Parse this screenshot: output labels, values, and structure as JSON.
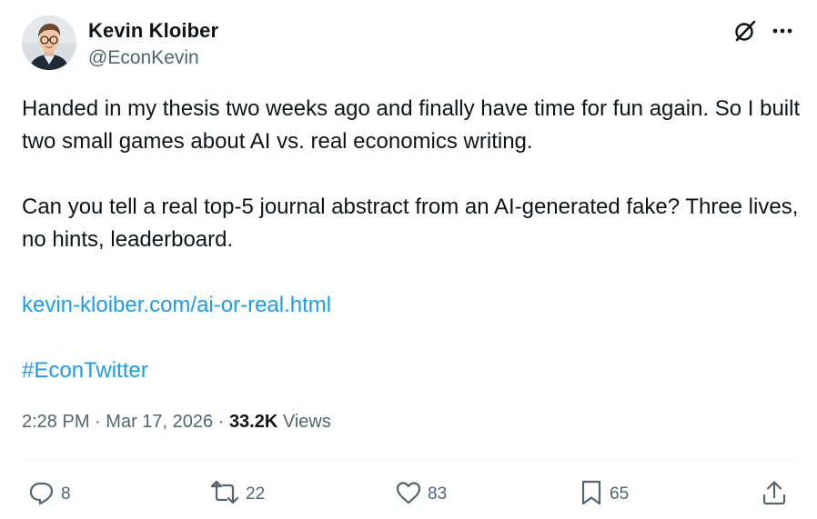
{
  "author": {
    "name": "Kevin Kloiber",
    "handle": "@EconKevin",
    "avatar_icon": "avatar-photo"
  },
  "header_icons": [
    "grok-icon",
    "more-options-icon"
  ],
  "tweet": {
    "paragraph_1": "Handed in my thesis two weeks ago and finally have time for fun again. So I built two small games about AI vs. real economics writing.",
    "paragraph_2": "Can you tell a real top-5 journal abstract from an AI-generated fake? Three lives, no hints, leaderboard.",
    "link": "kevin-kloiber.com/ai-or-real.html",
    "hashtag": "#EconTwitter"
  },
  "meta": {
    "time": "2:28 PM",
    "sep1": "·",
    "date": "Mar 17, 2026",
    "sep2": "·",
    "views_count": "33.2K",
    "views_label": "Views"
  },
  "actions": {
    "replies": "8",
    "reposts": "22",
    "likes": "83",
    "bookmarks": "65"
  },
  "colors": {
    "text": "#0f1419",
    "secondary": "#536471",
    "link": "#1d9bf0",
    "divider": "#eff3f4"
  }
}
